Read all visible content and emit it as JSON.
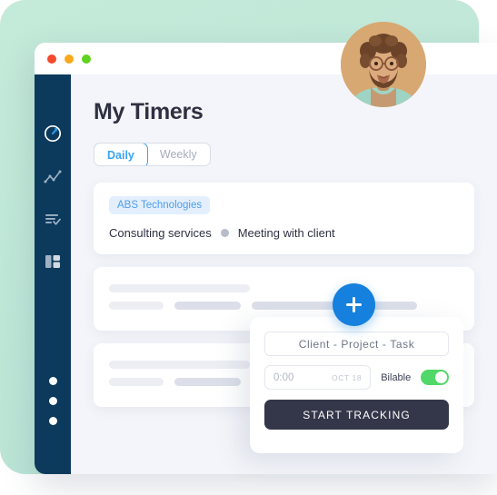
{
  "window": {
    "traffic_lights": [
      "close",
      "minimize",
      "maximize"
    ]
  },
  "sidebar": {
    "items": [
      {
        "icon": "timer-icon",
        "label": "Timer"
      },
      {
        "icon": "analytics-icon",
        "label": "Reports"
      },
      {
        "icon": "checklist-icon",
        "label": "Tasks"
      },
      {
        "icon": "dashboard-grid-icon",
        "label": "Dashboard"
      }
    ],
    "dots": [
      "dot-1",
      "dot-2",
      "dot-3"
    ]
  },
  "header": {
    "title": "My Timers"
  },
  "tabs": [
    {
      "label": "Daily",
      "active": true
    },
    {
      "label": "Weekly",
      "active": false
    }
  ],
  "timers": [
    {
      "tag": "ABS Technologies",
      "service": "Consulting services",
      "task": "Meeting with client"
    }
  ],
  "placeholder_cards": [
    {
      "id": "skeleton-card-1"
    },
    {
      "id": "skeleton-card-2"
    }
  ],
  "fab": {
    "label": "+",
    "name": "add-timer-button"
  },
  "popup": {
    "picker_value": "Client  -  Project  -  Task",
    "time_value": "0:00",
    "date_value": "OCT 18",
    "billable_label": "Bilable",
    "billable_on": true,
    "start_button": "START TRACKING"
  },
  "colors": {
    "backdrop": "#bfe7d8",
    "sidebar": "#0b3a5d",
    "accent_blue": "#3ba3f3",
    "fab_blue": "#1580dd",
    "tag_bg": "#e3effd",
    "tag_text": "#4f9eeb",
    "toggle_green": "#52d869",
    "button_dark": "#343749",
    "canvas": "#f4f5fa"
  }
}
